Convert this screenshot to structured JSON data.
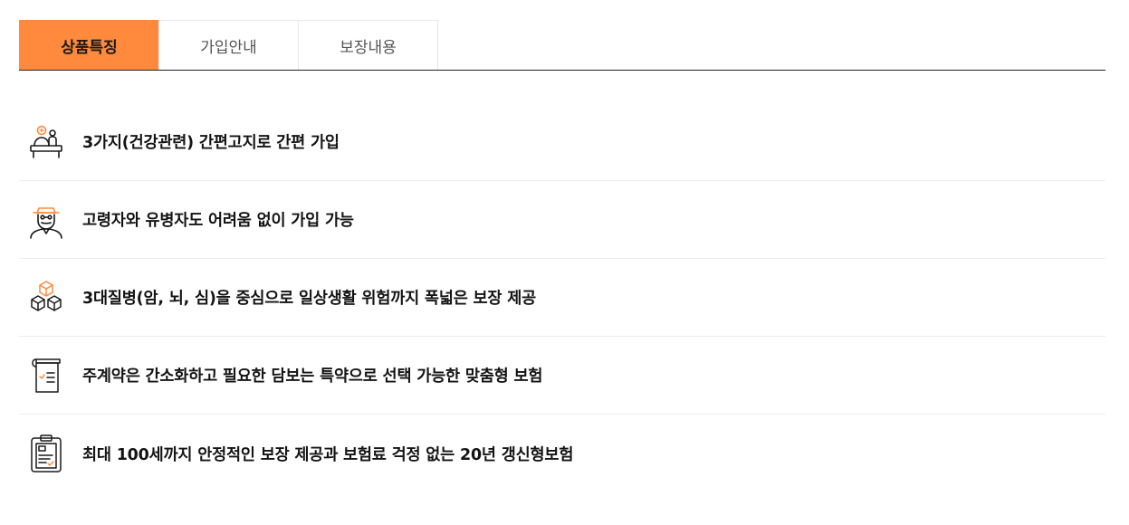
{
  "tabs": [
    {
      "label": "상품특징",
      "active": true
    },
    {
      "label": "가입안내",
      "active": false
    },
    {
      "label": "보장내용",
      "active": false
    }
  ],
  "features": [
    {
      "icon": "patient-consultation-icon",
      "text": "3가지(건강관련) 간편고지로 간편 가입"
    },
    {
      "icon": "elderly-man-icon",
      "text": "고령자와 유병자도 어려움 없이 가입 가능"
    },
    {
      "icon": "stacked-boxes-icon",
      "text": "3대질병(암, 뇌, 심)을 중심으로 일상생활 위험까지 폭넓은 보장 제공"
    },
    {
      "icon": "document-checklist-icon",
      "text": "주계약은 간소화하고 필요한 담보는 특약으로 선택 가능한 맞춤형 보험"
    },
    {
      "icon": "clipboard-check-icon",
      "text": "최대 100세까지 안정적인 보장 제공과 보험료 걱정 없는 20년 갱신형보험"
    }
  ],
  "colors": {
    "accent": "#ff8a3d",
    "text": "#141414",
    "divider": "#ececec"
  }
}
